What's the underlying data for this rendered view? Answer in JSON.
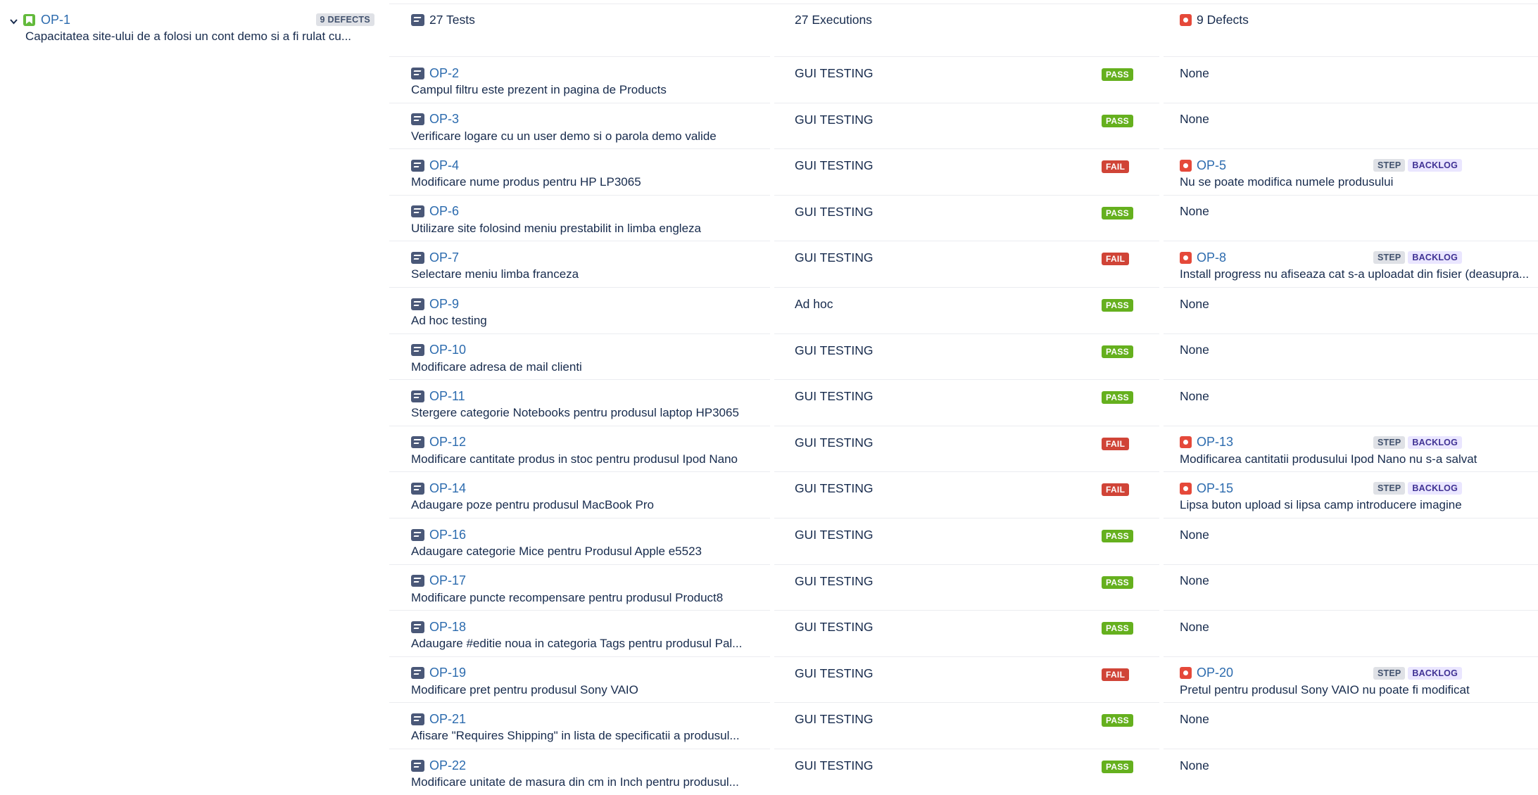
{
  "requirement": {
    "key": "OP-1",
    "summary": "Capacitatea site-ului de a folosi un cont demo si a fi rulat cu...",
    "defects_badge": "9 DEFECTS"
  },
  "header": {
    "tests": "27 Tests",
    "executions": "27 Executions",
    "defects": "9 Defects"
  },
  "rows": [
    {
      "key": "OP-2",
      "summary": "Campul filtru este prezent in pagina de Products",
      "exec": "GUI TESTING",
      "status": "PASS",
      "defect": "None"
    },
    {
      "key": "OP-3",
      "summary": "Verificare logare cu un user demo si o parola demo valide",
      "exec": "GUI TESTING",
      "status": "PASS",
      "defect": "None"
    },
    {
      "key": "OP-4",
      "summary": "Modificare nume produs pentru HP LP3065",
      "exec": "GUI TESTING",
      "status": "FAIL",
      "defect_key": "OP-5",
      "defect_summary": "Nu se poate modifica numele produsului",
      "tag1": "STEP",
      "tag2": "BACKLOG"
    },
    {
      "key": "OP-6",
      "summary": "Utilizare site folosind meniu prestabilit in limba engleza",
      "exec": "GUI TESTING",
      "status": "PASS",
      "defect": "None"
    },
    {
      "key": "OP-7",
      "summary": "Selectare meniu limba franceza",
      "exec": "GUI TESTING",
      "status": "FAIL",
      "defect_key": "OP-8",
      "defect_summary": "Install progress nu afiseaza cat s-a uploadat din fisier (deasupra...",
      "tag1": "STEP",
      "tag2": "BACKLOG"
    },
    {
      "key": "OP-9",
      "summary": "Ad hoc testing",
      "exec": "Ad hoc",
      "status": "PASS",
      "defect": "None"
    },
    {
      "key": "OP-10",
      "summary": "Modificare adresa de mail clienti",
      "exec": "GUI TESTING",
      "status": "PASS",
      "defect": "None"
    },
    {
      "key": "OP-11",
      "summary": "Stergere categorie Notebooks pentru produsul laptop HP3065",
      "exec": "GUI TESTING",
      "status": "PASS",
      "defect": "None"
    },
    {
      "key": "OP-12",
      "summary": "Modificare cantitate produs in stoc pentru produsul Ipod Nano",
      "exec": "GUI TESTING",
      "status": "FAIL",
      "defect_key": "OP-13",
      "defect_summary": "Modificarea cantitatii produsului Ipod Nano nu s-a salvat",
      "tag1": "STEP",
      "tag2": "BACKLOG"
    },
    {
      "key": "OP-14",
      "summary": "Adaugare poze pentru produsul MacBook Pro",
      "exec": "GUI TESTING",
      "status": "FAIL",
      "defect_key": "OP-15",
      "defect_summary": "Lipsa buton upload si lipsa camp introducere imagine",
      "tag1": "STEP",
      "tag2": "BACKLOG"
    },
    {
      "key": "OP-16",
      "summary": "Adaugare categorie Mice pentru Produsul Apple e5523",
      "exec": "GUI TESTING",
      "status": "PASS",
      "defect": "None"
    },
    {
      "key": "OP-17",
      "summary": "Modificare puncte recompensare pentru produsul Product8",
      "exec": "GUI TESTING",
      "status": "PASS",
      "defect": "None"
    },
    {
      "key": "OP-18",
      "summary": "Adaugare #editie noua in categoria Tags pentru produsul Pal...",
      "exec": "GUI TESTING",
      "status": "PASS",
      "defect": "None"
    },
    {
      "key": "OP-19",
      "summary": "Modificare pret pentru produsul Sony VAIO",
      "exec": "GUI TESTING",
      "status": "FAIL",
      "defect_key": "OP-20",
      "defect_summary": "Pretul pentru produsul Sony VAIO nu poate fi modificat",
      "tag1": "STEP",
      "tag2": "BACKLOG"
    },
    {
      "key": "OP-21",
      "summary": "Afisare \"Requires Shipping\" in lista de specificatii a produsul...",
      "exec": "GUI TESTING",
      "status": "PASS",
      "defect": "None"
    },
    {
      "key": "OP-22",
      "summary": "Modificare unitate de masura din cm in Inch pentru produsul...",
      "exec": "GUI TESTING",
      "status": "PASS",
      "defect": "None"
    }
  ]
}
